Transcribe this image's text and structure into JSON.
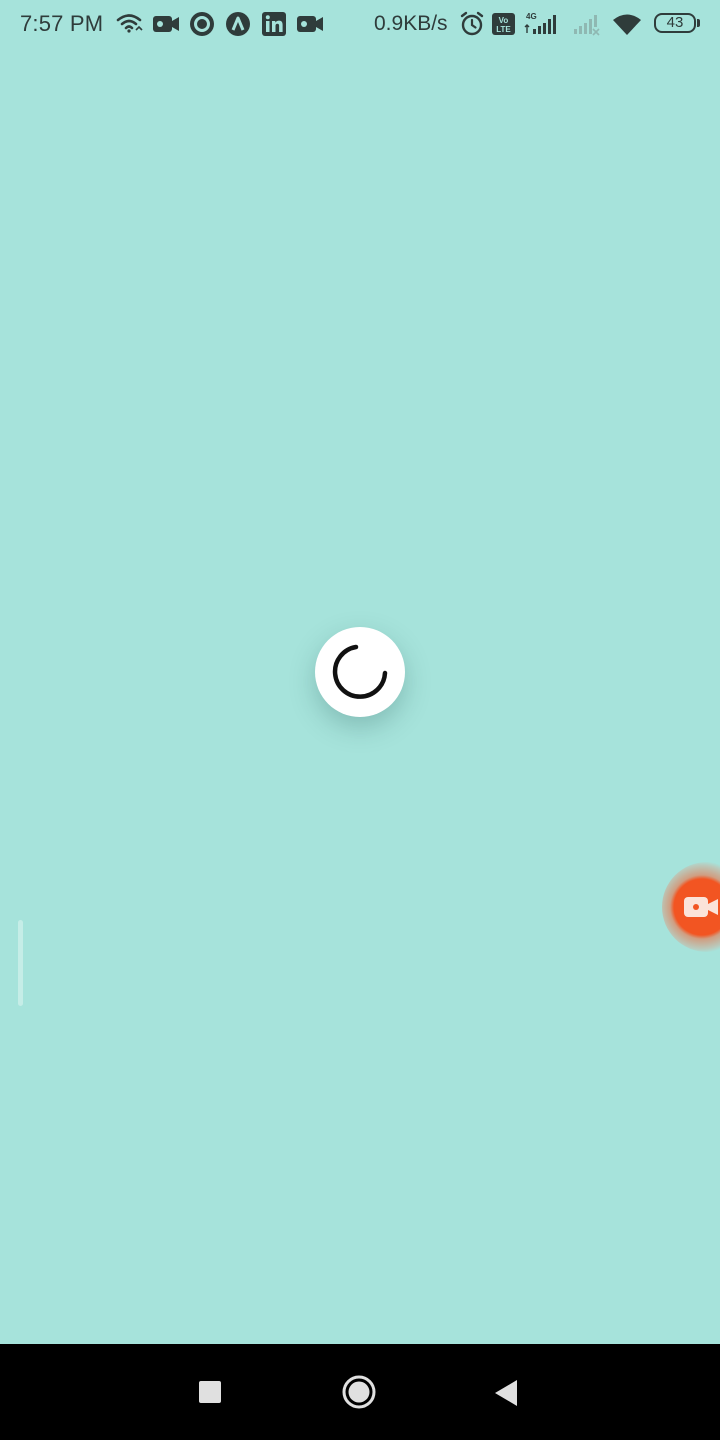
{
  "status_bar": {
    "time": "7:57 PM",
    "network_speed": "0.9KB/s",
    "battery_level": "43",
    "network_type": "4G",
    "volte_label": "Vo LTE",
    "icons": [
      "wifi-data-icon",
      "video-camera-icon",
      "circle-app-icon",
      "arrow-app-icon",
      "linkedin-icon",
      "video-camera-icon",
      "alarm-icon",
      "volte-icon",
      "signal-icon",
      "signal-empty-icon",
      "wifi-icon",
      "battery-icon"
    ]
  },
  "screen": {
    "background_color": "#a6e3db",
    "loading_indicator": "spinner-icon",
    "floating_button": "screen-recorder-icon",
    "floating_button_color": "#f25522"
  },
  "nav_bar": {
    "buttons": [
      "recents-button",
      "home-button",
      "back-button"
    ]
  }
}
